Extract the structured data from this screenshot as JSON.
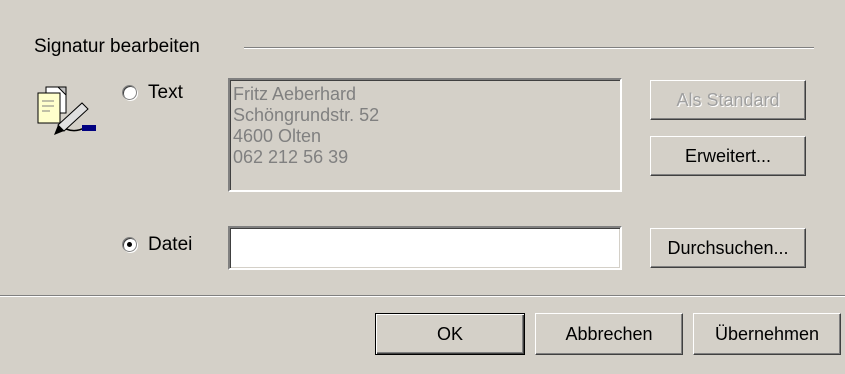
{
  "signature_group": {
    "title": "Signatur bearbeiten",
    "icon": "signature-edit-icon",
    "text_option": {
      "label": "Text",
      "selected": false,
      "lines": [
        "Fritz Aeberhard",
        "Schöngrundstr. 52",
        "4600 Olten",
        "062 212 56 39"
      ],
      "enabled": false
    },
    "file_option": {
      "label": "Datei",
      "selected": true,
      "value": ""
    },
    "buttons": {
      "set_default": "Als Standard",
      "advanced": "Erweitert...",
      "browse": "Durchsuchen..."
    }
  },
  "dialog_buttons": {
    "ok": "OK",
    "cancel": "Abbrechen",
    "apply": "Übernehmen"
  }
}
